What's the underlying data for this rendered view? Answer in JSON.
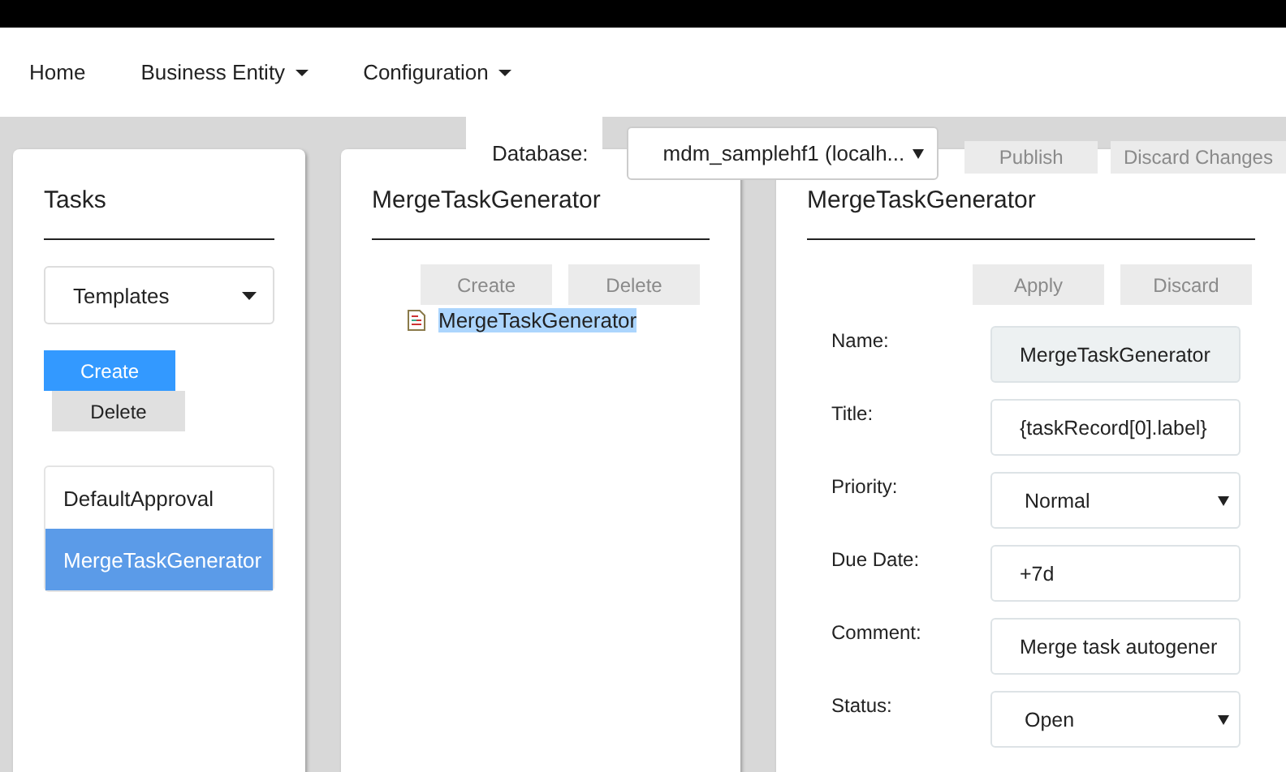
{
  "nav": [
    {
      "label": "Home",
      "dropdown": false
    },
    {
      "label": "Business Entity",
      "dropdown": true
    },
    {
      "label": "Configuration",
      "dropdown": true
    }
  ],
  "toolbar": {
    "database_label": "Database:",
    "database_value": "mdm_samplehf1 (localh...",
    "buttons": [
      {
        "label": "Publish",
        "disabled": true
      },
      {
        "label": "Discard Changes",
        "disabled": true
      }
    ]
  },
  "tasks_panel": {
    "title": "Tasks",
    "filter": "Templates",
    "buttons": [
      {
        "label": "Create",
        "kind": "primary"
      },
      {
        "label": "Delete",
        "kind": "secondary"
      }
    ],
    "items": [
      {
        "label": "DefaultApproval",
        "selected": false
      },
      {
        "label": "MergeTaskGenerator",
        "selected": true
      }
    ]
  },
  "tree_panel": {
    "title": "MergeTaskGenerator",
    "buttons": [
      {
        "label": "Create",
        "disabled": true
      },
      {
        "label": "Delete",
        "disabled": true
      }
    ],
    "nodes": [
      {
        "label": "MergeTaskGenerator",
        "selected": true
      }
    ]
  },
  "detail_panel": {
    "title": "MergeTaskGenerator",
    "buttons": [
      {
        "label": "Apply",
        "disabled": true
      },
      {
        "label": "Discard",
        "disabled": true
      }
    ],
    "fields": [
      {
        "label": "Name:",
        "value": "MergeTaskGenerator",
        "kind": "readonly"
      },
      {
        "label": "Title:",
        "value": "{taskRecord[0].label}",
        "kind": "text"
      },
      {
        "label": "Priority:",
        "value": "Normal",
        "kind": "select"
      },
      {
        "label": "Due Date:",
        "value": "+7d",
        "kind": "text"
      },
      {
        "label": "Comment:",
        "value": "Merge task autogener",
        "kind": "text"
      },
      {
        "label": "Status:",
        "value": "Open",
        "kind": "select"
      }
    ]
  }
}
